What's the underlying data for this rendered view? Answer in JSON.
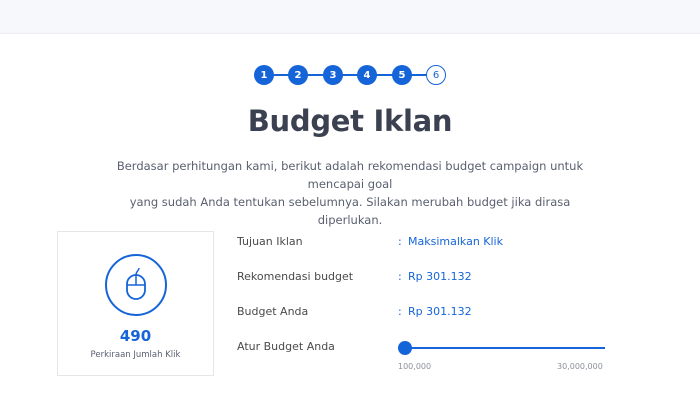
{
  "steps": [
    {
      "label": "1",
      "state": "done"
    },
    {
      "label": "2",
      "state": "done"
    },
    {
      "label": "3",
      "state": "done"
    },
    {
      "label": "4",
      "state": "done"
    },
    {
      "label": "5",
      "state": "done"
    },
    {
      "label": "6",
      "state": "current"
    }
  ],
  "title": "Budget Iklan",
  "description_line1": "Berdasar perhitungan kami, berikut adalah rekomendasi budget campaign untuk mencapai goal",
  "description_line2": "yang sudah Anda tentukan sebelumnya. Silakan merubah budget jika dirasa diperlukan.",
  "estimate": {
    "icon": "mouse-icon",
    "value": "490",
    "label": "Perkiraan Jumlah Klik"
  },
  "details": {
    "objective_label": "Tujuan Iklan",
    "objective_value": "Maksimalkan Klik",
    "recommended_label": "Rekomendasi budget",
    "recommended_value": "Rp 301.132",
    "your_budget_label": "Budget Anda",
    "your_budget_value": "Rp 301.132",
    "slider_label": "Atur Budget Anda",
    "colon": ":"
  },
  "slider": {
    "min_label": "100,000",
    "max_label": "30,000,000",
    "value_fraction": 0.0
  },
  "colors": {
    "accent": "#1565d8",
    "text": "#4a4a4a",
    "muted": "#8a8f99"
  }
}
